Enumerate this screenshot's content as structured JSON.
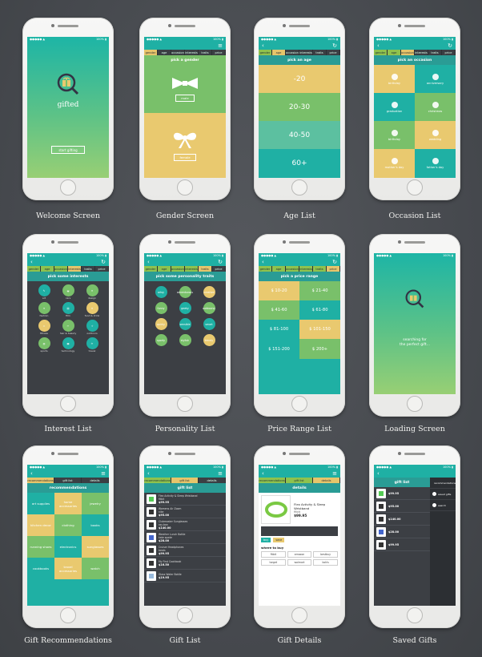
{
  "captions": [
    "Welcome Screen",
    "Gender Screen",
    "Age List",
    "Occasion List",
    "Interest List",
    "Personality List",
    "Price Range List",
    "Loading Screen",
    "Gift Recommendations",
    "Gift List",
    "Gift Details",
    "Saved Gifts"
  ],
  "welcome": {
    "app_name": "gifted",
    "start_button": "start gifting"
  },
  "crumbs": [
    "gender",
    "age",
    "occasion",
    "interests",
    "traits",
    "price"
  ],
  "gender": {
    "title": "pick a gender",
    "male": "male",
    "female": "female"
  },
  "age": {
    "title": "pick an age",
    "options": [
      "-20",
      "20-30",
      "40-50",
      "60+"
    ]
  },
  "occasion": {
    "title": "pick an occasion",
    "options": [
      "birthday",
      "anniversary",
      "graduation",
      "christmas",
      "birthday",
      "wedding",
      "mother's day",
      "father's day"
    ]
  },
  "interests": {
    "title": "pick some interests",
    "options": [
      "art",
      "cars",
      "design",
      "fashion",
      "film",
      "food & drink",
      "fitness",
      "hair & beauty",
      "outdoors",
      "sports",
      "technology",
      "travel"
    ]
  },
  "personality": {
    "title": "pick some personality traits",
    "options": [
      "artsy",
      "adventurous",
      "creative",
      "funny",
      "geeky",
      "outdoorsy",
      "quirky",
      "sensible",
      "smart",
      "sporty",
      "stylish",
      "trendy"
    ]
  },
  "price": {
    "title": "pick a price range",
    "options": [
      "$ 10-20",
      "$ 21-40",
      "$ 41-60",
      "$ 61-80",
      "$ 81-100",
      "$ 101-150",
      "$ 151-200",
      "$ 200+"
    ]
  },
  "loading": {
    "text_line1": "searching for",
    "text_line2": "the perfect gift..."
  },
  "recs": {
    "crumbs": [
      "recommendations",
      "gift list",
      "details"
    ],
    "title": "recommendations",
    "options": [
      "art supplies",
      "home accessories",
      "jewelry",
      "kitchen decor",
      "clothing",
      "books",
      "running shoes",
      "electronics",
      "sunglasses",
      "cookbooks",
      "travel accessories",
      "watch"
    ]
  },
  "giftlist": {
    "title": "gift list",
    "items": [
      {
        "name": "Flex Activity & Sleep Wristband",
        "brand": "fitbit",
        "price": "$99.95"
      },
      {
        "name": "Womens Air Zoom",
        "brand": "nike",
        "price": "$95.00"
      },
      {
        "name": "Clubmaster Sunglasses",
        "brand": "ray-ban",
        "price": "$140.00"
      },
      {
        "name": "Weather Lunch Bottle",
        "brand": "kate spade",
        "price": "$28.00"
      },
      {
        "name": "Cruiser Headphones",
        "brand": "beats",
        "price": "$99.95"
      },
      {
        "name": "My First Cookbook",
        "brand": "",
        "price": "$16.50"
      },
      {
        "name": "Glass Water Bottle",
        "brand": "",
        "price": "$19.95"
      }
    ]
  },
  "details": {
    "title": "details",
    "product_name": "Flex Activity & Sleep Wristband",
    "brand": "fitbit",
    "price": "$99.95",
    "buy": "buy",
    "save": "save",
    "where_to_buy": "where to buy",
    "stores": [
      "fitbit",
      "amazon",
      "bestbuy",
      "target",
      "walmart",
      "kohls"
    ]
  },
  "saved": {
    "title": "gift list",
    "menu": [
      "recommendations",
      "saved gifts",
      "search"
    ],
    "prices": [
      "$99.95",
      "$95.00",
      "$140.00",
      "$28.00",
      "$99.95"
    ]
  },
  "colors": {
    "teal": "#1fb0a4",
    "green": "#79c06a",
    "yellow": "#e9c96f",
    "dark": "#3c3f44"
  }
}
